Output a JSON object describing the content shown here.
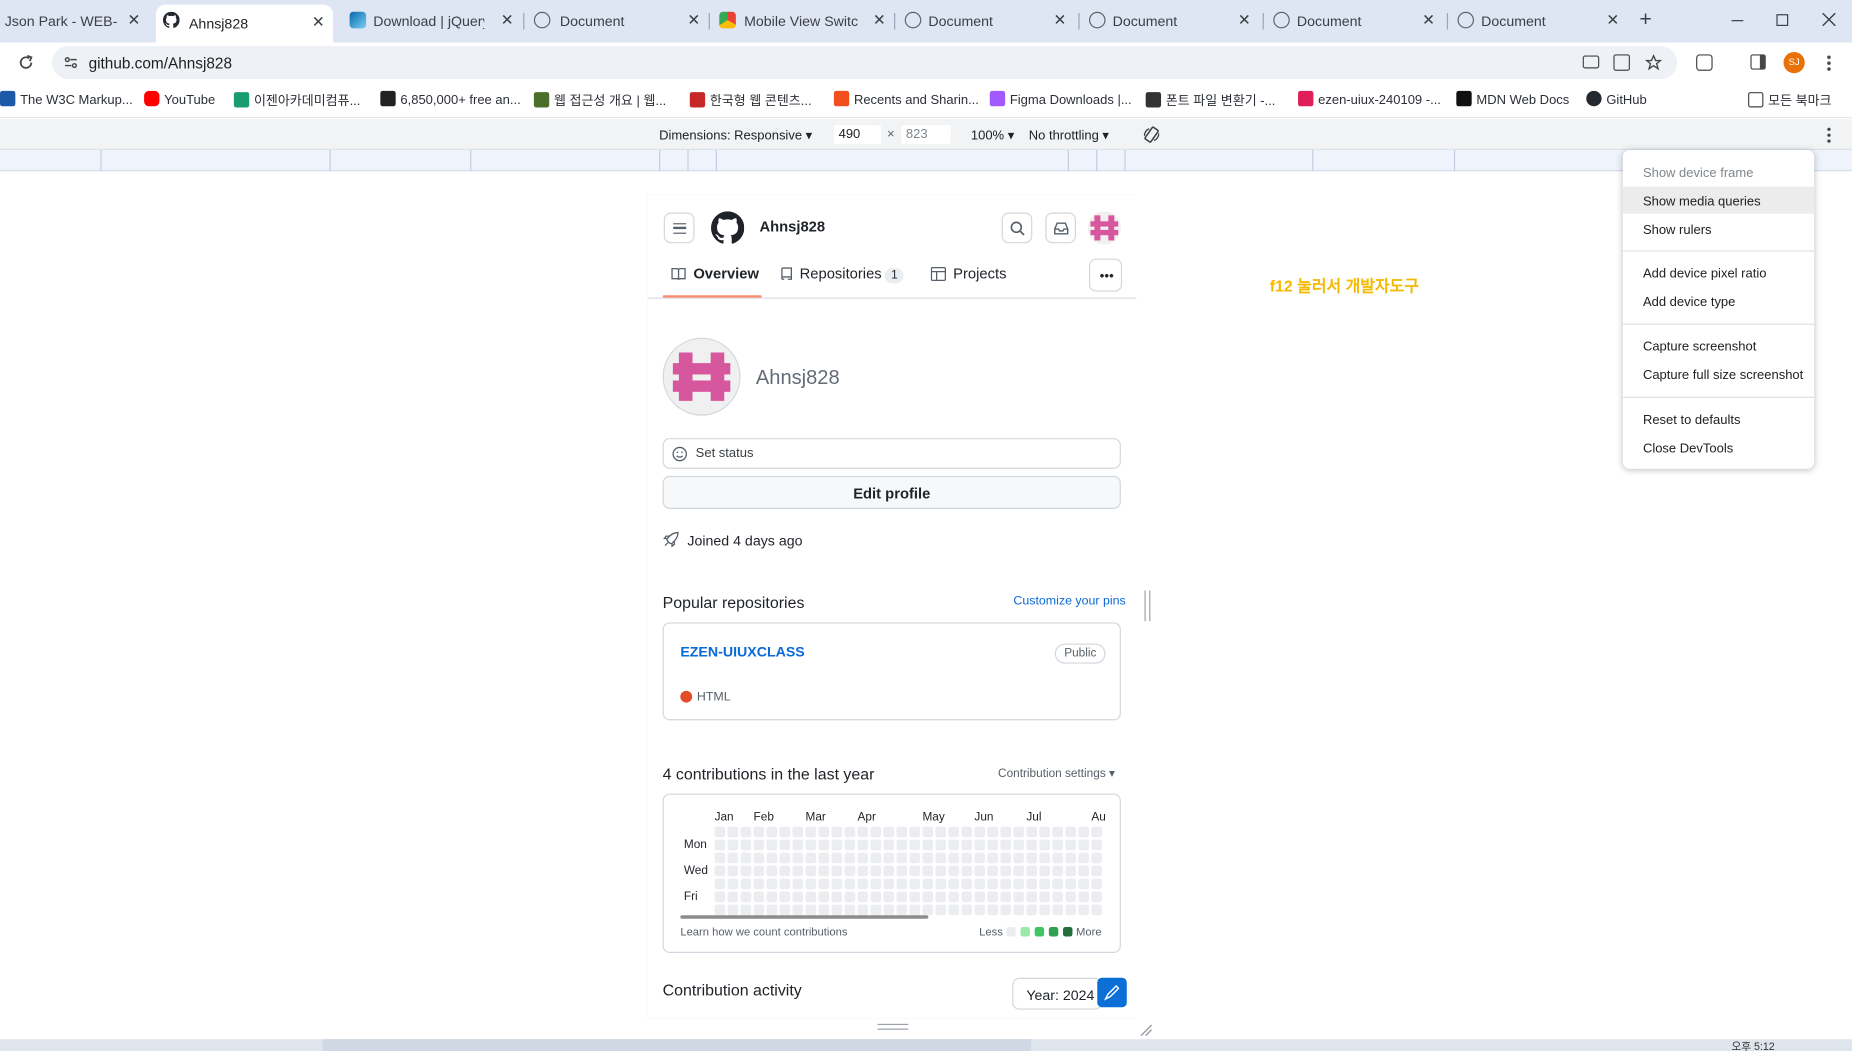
{
  "browser": {
    "tabs": [
      {
        "title": "Json Park - WEB-UIU",
        "icon": "generic-icon"
      },
      {
        "title": "Ahnsj828",
        "icon": "github-icon",
        "active": true
      },
      {
        "title": "Download | jQuery M",
        "icon": "jquery-icon"
      },
      {
        "title": "Document",
        "icon": "globe-icon"
      },
      {
        "title": "Mobile View Switche",
        "icon": "chrome-store-icon"
      },
      {
        "title": "Document",
        "icon": "globe-icon"
      },
      {
        "title": "Document",
        "icon": "globe-icon"
      },
      {
        "title": "Document",
        "icon": "globe-icon"
      },
      {
        "title": "Document",
        "icon": "globe-icon"
      }
    ],
    "close_glyph": "✕",
    "new_tab_glyph": "+",
    "url": "github.com/Ahnsj828",
    "profile_initials": "SJ",
    "bookmarks": [
      {
        "label": "The W3C Markup...",
        "color": "#1c5aa8"
      },
      {
        "label": "YouTube",
        "color": "#ff0000"
      },
      {
        "label": "이젠아카데미컴퓨...",
        "color": "#1a9c72"
      },
      {
        "label": "6,850,000+ free an...",
        "color": "#222222"
      },
      {
        "label": "웹 접근성 개요 | 웹...",
        "color": "#4a6f2a"
      },
      {
        "label": "한국형 웹 콘텐츠...",
        "color": "#c62828"
      },
      {
        "label": "Recents and Sharin...",
        "color": "#f24e1e"
      },
      {
        "label": "Figma Downloads |...",
        "color": "#a259ff"
      },
      {
        "label": "폰트 파일 변환기 -...",
        "color": "#333333"
      },
      {
        "label": "ezen-uiux-240109 -...",
        "color": "#e01e5a"
      },
      {
        "label": "MDN Web Docs",
        "color": "#111111"
      },
      {
        "label": "GitHub",
        "color": "#24292f"
      }
    ],
    "all_bookmarks": "모든 북마크"
  },
  "devtools": {
    "dimensions_label": "Dimensions: Responsive",
    "width": "490",
    "times": "×",
    "height": "823",
    "zoom": "100%",
    "throttling": "No throttling",
    "menu": {
      "show_device_frame": "Show device frame",
      "show_media_queries": "Show media queries",
      "show_rulers": "Show rulers",
      "add_device_pixel_ratio": "Add device pixel ratio",
      "add_device_type": "Add device type",
      "capture_screenshot": "Capture screenshot",
      "capture_full_size_screenshot": "Capture full size screenshot",
      "reset_to_defaults": "Reset to defaults",
      "close_devtools": "Close DevTools"
    }
  },
  "annotation": "f12 눌러서 개발자도구",
  "github": {
    "username": "Ahnsj828",
    "nav": {
      "overview": "Overview",
      "repositories": "Repositories",
      "repositories_count": "1",
      "projects": "Projects"
    },
    "display_name": "Ahnsj828",
    "set_status": "Set status",
    "edit_profile": "Edit profile",
    "joined": "Joined 4 days ago",
    "popular_repos_title": "Popular repositories",
    "customize_pins": "Customize your pins",
    "repo": {
      "name": "EZEN-UIUXCLASS",
      "visibility": "Public",
      "language": "HTML",
      "language_color": "#e34c26"
    },
    "contrib_title": "4 contributions in the last year",
    "contrib_settings": "Contribution settings",
    "months": [
      "Jan",
      "Feb",
      "Mar",
      "Apr",
      "May",
      "Jun",
      "Jul",
      "Au"
    ],
    "days": [
      "Mon",
      "Wed",
      "Fri"
    ],
    "learn_link": "Learn how we count contributions",
    "less": "Less",
    "more": "More",
    "legend_colors": [
      "#ebedf0",
      "#9be9a8",
      "#40c463",
      "#30a14e",
      "#216e39"
    ],
    "activity_title": "Contribution activity",
    "year": "Year: 2024"
  },
  "taskbar": {
    "clock": "오후 5:12"
  }
}
